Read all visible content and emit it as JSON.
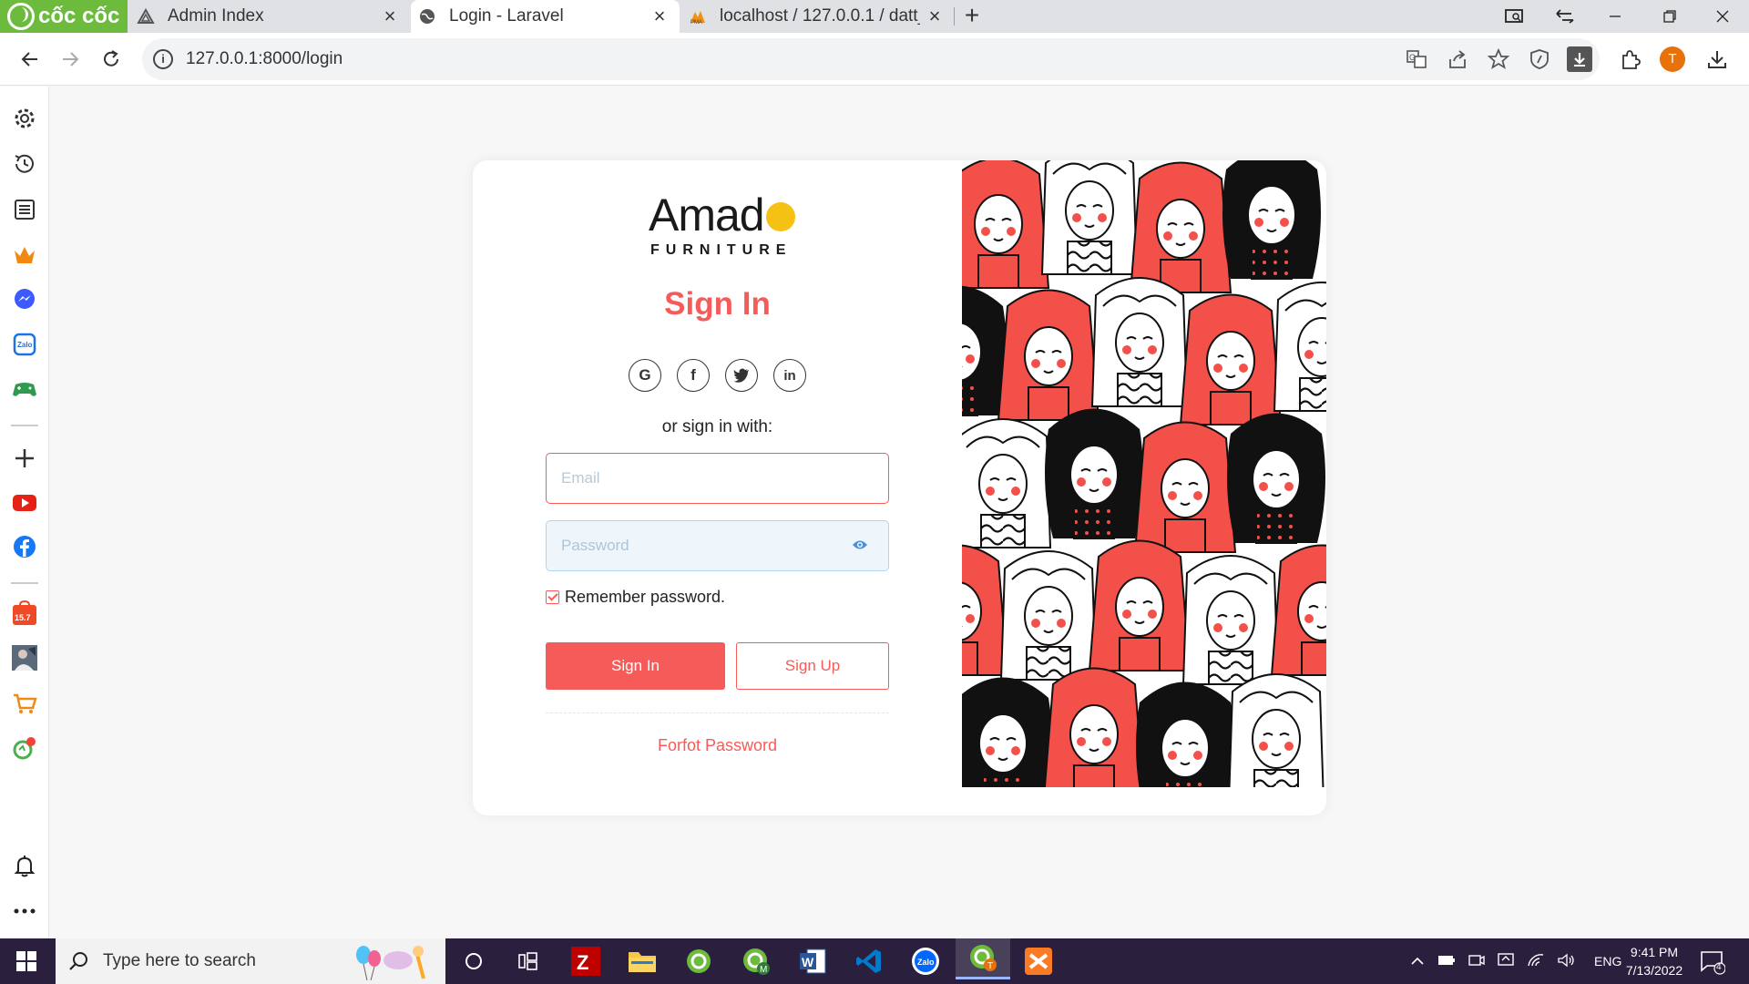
{
  "browser": {
    "brand": "cốc cốc",
    "tabs": [
      {
        "title": "Admin Index"
      },
      {
        "title": "Login - Laravel"
      },
      {
        "title": "localhost / 127.0.0.1 / datt_q"
      }
    ],
    "url": "127.0.0.1:8000/login"
  },
  "sidebar": {
    "items": [
      "gear-icon",
      "history-icon",
      "list-icon",
      "crown-icon",
      "messenger-icon",
      "zalo-icon",
      "gamepad-icon",
      "plus-icon",
      "youtube-icon",
      "facebook-icon",
      "shopping-badge-icon",
      "profile-photo-icon",
      "game-shop-icon",
      "coccoc-green-icon",
      "bell-icon",
      "more-icon"
    ],
    "shopping_badge": "15.7",
    "zalo_label": "Zalo"
  },
  "login": {
    "logo_word": "Amad",
    "logo_sub": "FURNITURE",
    "title": "Sign In",
    "social": [
      "G",
      "f",
      "twitter",
      "in"
    ],
    "or_text": "or sign in with:",
    "email_placeholder": "Email",
    "password_placeholder": "Password",
    "remember_label": "Remember password.",
    "signin_button": "Sign In",
    "signup_button": "Sign Up",
    "forgot_link": "Forfot Password"
  },
  "taskbar": {
    "search_placeholder": "Type here to search",
    "language": "ENG",
    "time": "9:41 PM",
    "date": "7/13/2022",
    "notification_count": "4"
  },
  "colors": {
    "accent": "#f55c59",
    "logo_dot": "#f5c113",
    "coccoc_green": "#6cbb3c",
    "taskbar": "#2a1f3d"
  }
}
